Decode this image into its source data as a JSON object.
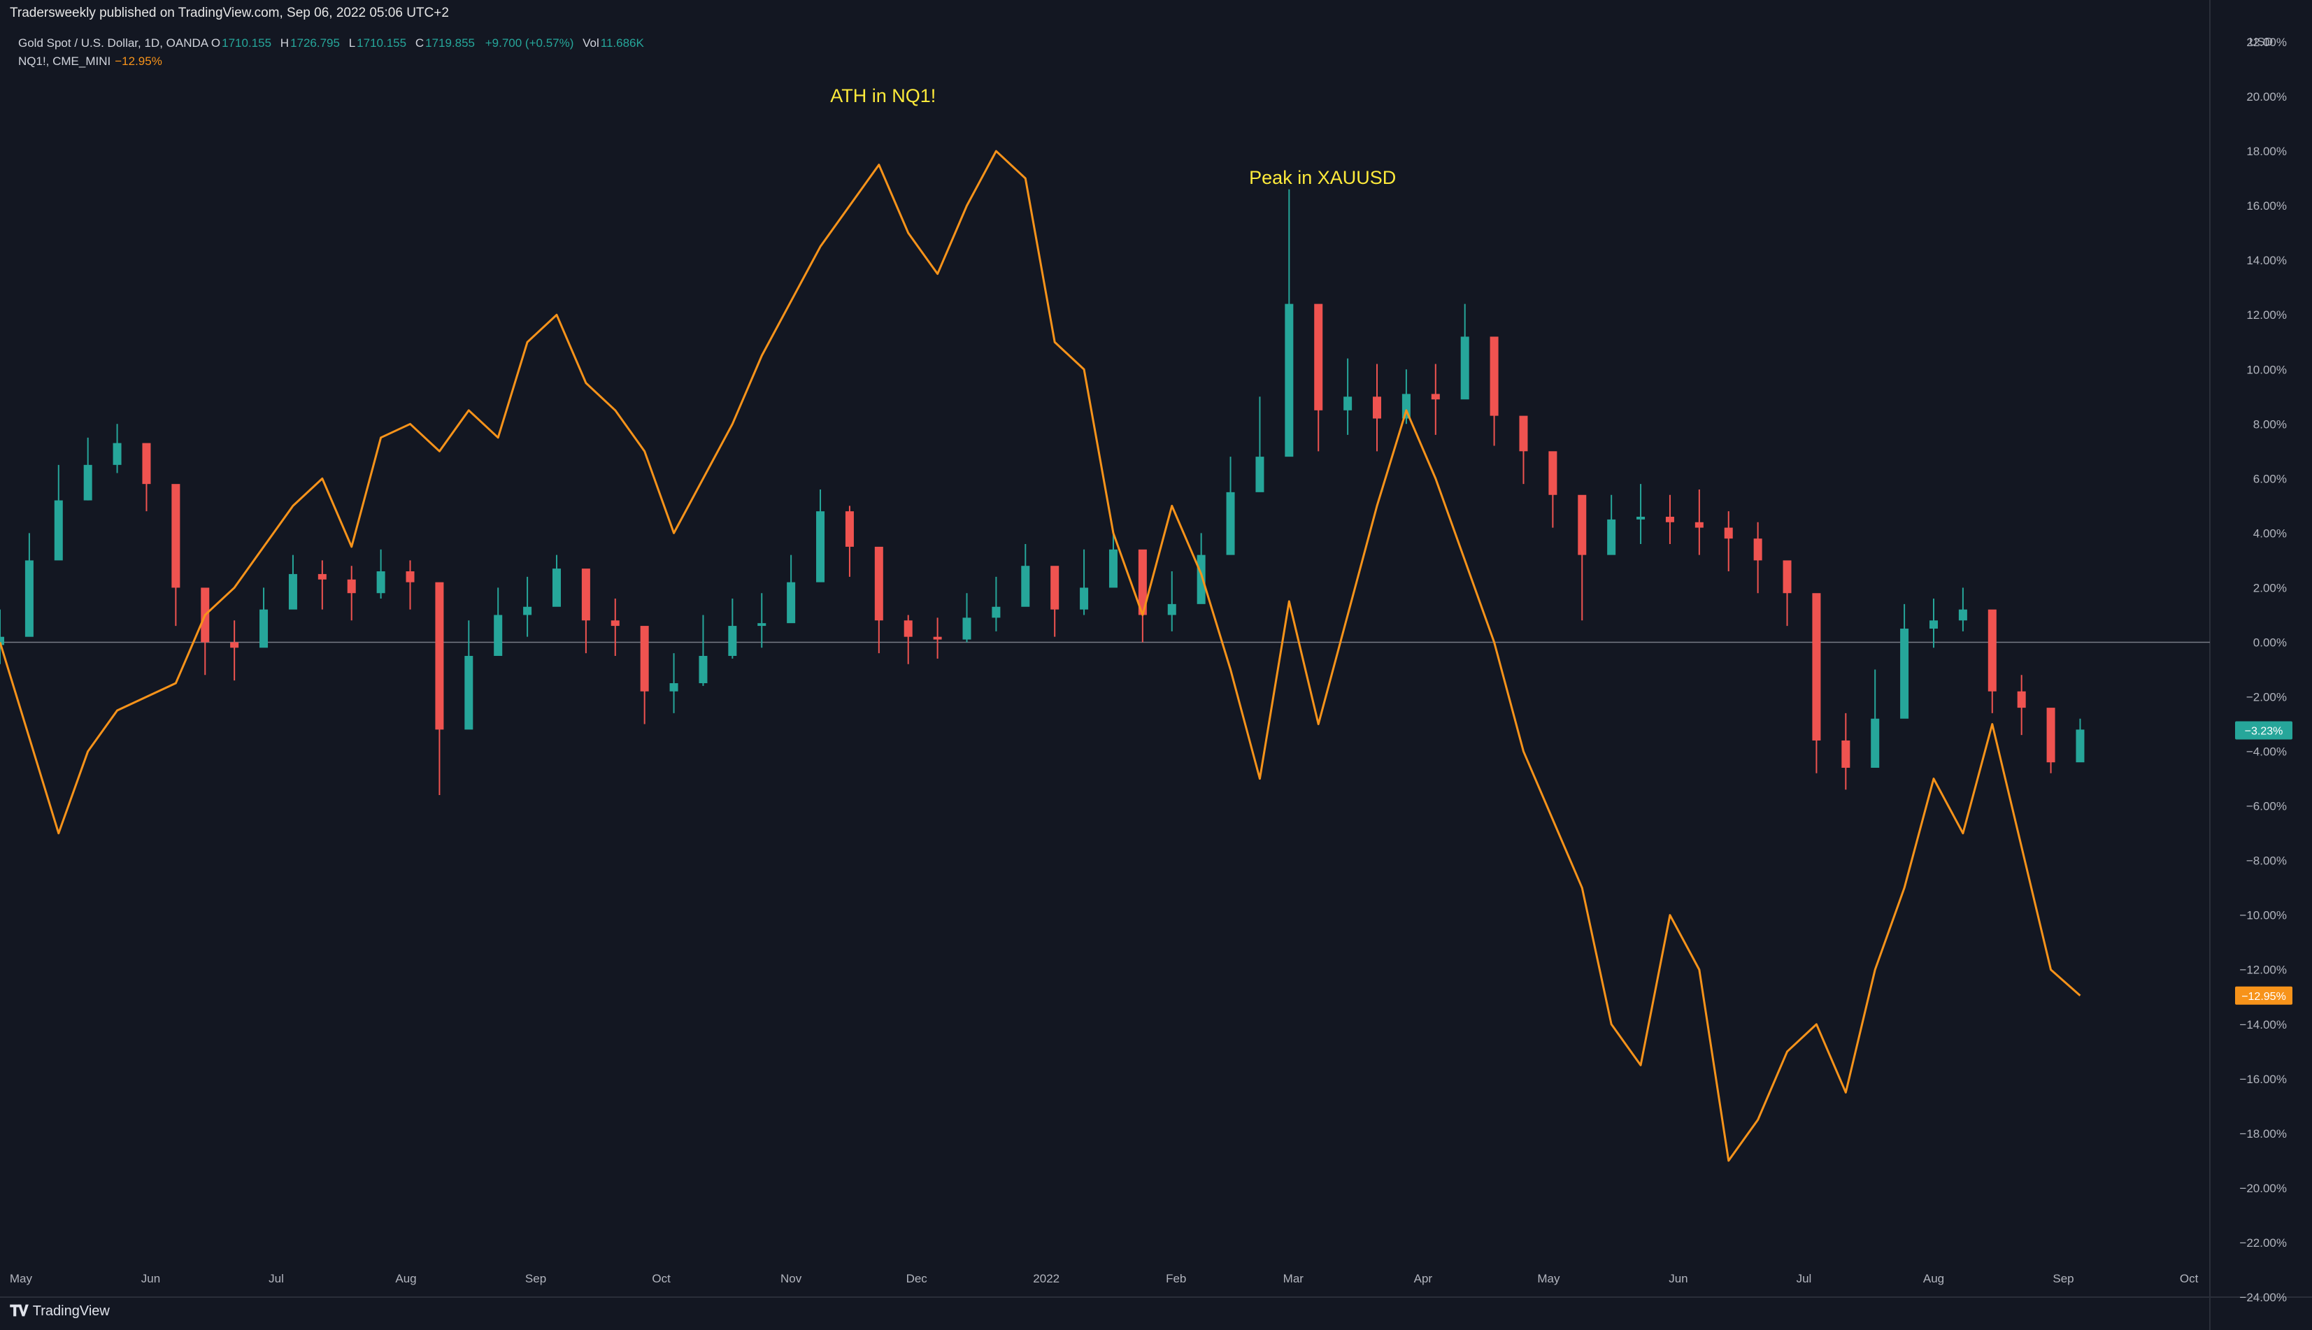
{
  "publish_line": "Tradersweekly published on TradingView.com, Sep 06, 2022 05:06 UTC+2",
  "legend": {
    "gold": {
      "name": "Gold Spot / U.S. Dollar, 1D, OANDA",
      "o_label": "O",
      "o": "1710.155",
      "h_label": "H",
      "h": "1726.795",
      "l_label": "L",
      "l": "1710.155",
      "c_label": "C",
      "c": "1719.855",
      "change": "+9.700 (+0.57%)",
      "vol_label": "Vol",
      "vol": "11.686K"
    },
    "nq": {
      "name": "NQ1!, CME_MINI",
      "value": "−12.95%"
    }
  },
  "currency_label": "USD",
  "footer_logo": "TradingView",
  "colors": {
    "background": "#131722",
    "up_candle": "#26a69a",
    "down_candle": "#ef5350",
    "nq_line": "#f7931a",
    "annotation": "#ffeb3b",
    "zero_line": "#787b86"
  },
  "chart_data": {
    "type": "line",
    "title": "",
    "xlabel": "",
    "ylabel": "",
    "y_unit": "%",
    "ylim": [
      -24,
      22
    ],
    "grid": false,
    "y_ticks": [
      "22.00%",
      "20.00%",
      "18.00%",
      "16.00%",
      "14.00%",
      "12.00%",
      "10.00%",
      "8.00%",
      "6.00%",
      "4.00%",
      "2.00%",
      "0.00%",
      "−2.00%",
      "−4.00%",
      "−6.00%",
      "−8.00%",
      "−10.00%",
      "−12.00%",
      "−14.00%",
      "−16.00%",
      "−18.00%",
      "−20.00%",
      "−22.00%",
      "−24.00%"
    ],
    "y_tick_values": [
      22,
      20,
      18,
      16,
      14,
      12,
      10,
      8,
      6,
      4,
      2,
      0,
      -2,
      -4,
      -6,
      -8,
      -10,
      -12,
      -14,
      -16,
      -18,
      -20,
      -22,
      -24
    ],
    "x_range": [
      "2021-04-26",
      "2022-10-06"
    ],
    "x_ticks": [
      {
        "label": "May",
        "date": "2021-05-01"
      },
      {
        "label": "Jun",
        "date": "2021-06-01"
      },
      {
        "label": "Jul",
        "date": "2021-07-01"
      },
      {
        "label": "Aug",
        "date": "2021-08-01"
      },
      {
        "label": "Sep",
        "date": "2021-09-01"
      },
      {
        "label": "Oct",
        "date": "2021-10-01"
      },
      {
        "label": "Nov",
        "date": "2021-11-01"
      },
      {
        "label": "Dec",
        "date": "2021-12-01"
      },
      {
        "label": "2022",
        "date": "2022-01-01"
      },
      {
        "label": "Feb",
        "date": "2022-02-01"
      },
      {
        "label": "Mar",
        "date": "2022-03-01"
      },
      {
        "label": "Apr",
        "date": "2022-04-01"
      },
      {
        "label": "May",
        "date": "2022-05-01"
      },
      {
        "label": "Jun",
        "date": "2022-06-01"
      },
      {
        "label": "Jul",
        "date": "2022-07-01"
      },
      {
        "label": "Aug",
        "date": "2022-08-01"
      },
      {
        "label": "Sep",
        "date": "2022-09-01"
      },
      {
        "label": "Oct",
        "date": "2022-10-01"
      }
    ],
    "series": [
      {
        "name": "Gold Spot / U.S. Dollar",
        "kind": "candlestick",
        "x": [
          "2021-04-26",
          "2021-05-03",
          "2021-05-10",
          "2021-05-17",
          "2021-05-24",
          "2021-05-31",
          "2021-06-07",
          "2021-06-14",
          "2021-06-21",
          "2021-06-28",
          "2021-07-05",
          "2021-07-12",
          "2021-07-19",
          "2021-07-26",
          "2021-08-02",
          "2021-08-09",
          "2021-08-16",
          "2021-08-23",
          "2021-08-30",
          "2021-09-06",
          "2021-09-13",
          "2021-09-20",
          "2021-09-27",
          "2021-10-04",
          "2021-10-11",
          "2021-10-18",
          "2021-10-25",
          "2021-11-01",
          "2021-11-08",
          "2021-11-15",
          "2021-11-22",
          "2021-11-29",
          "2021-12-06",
          "2021-12-13",
          "2021-12-20",
          "2021-12-27",
          "2022-01-03",
          "2022-01-10",
          "2022-01-17",
          "2022-01-24",
          "2022-01-31",
          "2022-02-07",
          "2022-02-14",
          "2022-02-21",
          "2022-02-28",
          "2022-03-07",
          "2022-03-14",
          "2022-03-21",
          "2022-03-28",
          "2022-04-04",
          "2022-04-11",
          "2022-04-18",
          "2022-04-25",
          "2022-05-02",
          "2022-05-09",
          "2022-05-16",
          "2022-05-23",
          "2022-05-30",
          "2022-06-06",
          "2022-06-13",
          "2022-06-20",
          "2022-06-27",
          "2022-07-04",
          "2022-07-11",
          "2022-07-18",
          "2022-07-25",
          "2022-08-01",
          "2022-08-08",
          "2022-08-15",
          "2022-08-22",
          "2022-08-29",
          "2022-09-05"
        ],
        "values": [
          0.2,
          3.0,
          5.2,
          6.5,
          7.3,
          5.8,
          2.0,
          0.0,
          -0.2,
          1.2,
          2.5,
          2.3,
          1.8,
          2.6,
          2.2,
          -3.2,
          -0.5,
          1.0,
          1.3,
          2.7,
          0.8,
          0.6,
          -1.8,
          -1.5,
          -0.5,
          0.6,
          0.7,
          2.2,
          4.8,
          3.5,
          0.8,
          0.2,
          0.1,
          0.9,
          1.3,
          2.8,
          1.2,
          2.0,
          3.4,
          1.0,
          1.4,
          3.2,
          5.5,
          6.8,
          12.4,
          8.5,
          9.0,
          8.2,
          9.1,
          8.9,
          11.2,
          8.3,
          7.0,
          5.4,
          3.2,
          4.5,
          4.6,
          4.4,
          4.2,
          3.8,
          3.0,
          1.8,
          -3.6,
          -4.6,
          -2.8,
          0.5,
          0.8,
          1.2,
          -1.8,
          -2.4,
          -4.4,
          -3.2
        ],
        "highs": [
          1.2,
          4.0,
          6.5,
          7.5,
          8.0,
          7.0,
          3.0,
          1.5,
          0.8,
          2.0,
          3.2,
          3.0,
          2.8,
          3.4,
          3.0,
          -1.0,
          0.8,
          2.0,
          2.4,
          3.2,
          1.8,
          1.6,
          -0.4,
          -0.4,
          1.0,
          1.6,
          1.8,
          3.2,
          5.6,
          5.0,
          1.6,
          1.0,
          0.9,
          1.8,
          2.4,
          3.6,
          2.4,
          3.4,
          4.0,
          2.2,
          2.6,
          4.0,
          6.8,
          9.0,
          16.6,
          12.0,
          10.4,
          10.2,
          10.0,
          10.2,
          12.4,
          10.6,
          8.2,
          6.6,
          4.6,
          5.4,
          5.8,
          5.4,
          5.6,
          4.8,
          4.4,
          2.8,
          -1.4,
          -2.6,
          -1.0,
          1.4,
          1.6,
          2.0,
          0.4,
          -1.2,
          -3.0,
          -2.8
        ],
        "lows": [
          -0.8,
          1.8,
          4.0,
          5.2,
          6.2,
          4.8,
          0.6,
          -1.2,
          -1.4,
          0.2,
          1.4,
          1.2,
          0.8,
          1.6,
          1.2,
          -5.6,
          -1.8,
          0.0,
          0.2,
          1.6,
          -0.4,
          -0.5,
          -3.0,
          -2.6,
          -1.6,
          -0.6,
          -0.2,
          1.0,
          3.6,
          2.4,
          -0.4,
          -0.8,
          -0.6,
          0.0,
          0.4,
          1.8,
          0.2,
          1.0,
          2.4,
          0.0,
          0.4,
          2.0,
          4.2,
          5.8,
          8.4,
          7.0,
          7.6,
          7.0,
          8.0,
          7.6,
          9.8,
          7.2,
          5.8,
          4.2,
          0.8,
          3.4,
          3.6,
          3.6,
          3.2,
          2.6,
          1.8,
          0.6,
          -4.8,
          -5.4,
          -4.0,
          -0.6,
          -0.2,
          0.4,
          -2.6,
          -3.4,
          -4.8,
          -4.2
        ]
      },
      {
        "name": "NQ1!, CME_MINI",
        "kind": "line",
        "x": [
          "2021-04-26",
          "2021-05-03",
          "2021-05-10",
          "2021-05-17",
          "2021-05-24",
          "2021-05-31",
          "2021-06-07",
          "2021-06-14",
          "2021-06-21",
          "2021-06-28",
          "2021-07-05",
          "2021-07-12",
          "2021-07-19",
          "2021-07-26",
          "2021-08-02",
          "2021-08-09",
          "2021-08-16",
          "2021-08-23",
          "2021-08-30",
          "2021-09-06",
          "2021-09-13",
          "2021-09-20",
          "2021-09-27",
          "2021-10-04",
          "2021-10-11",
          "2021-10-18",
          "2021-10-25",
          "2021-11-01",
          "2021-11-08",
          "2021-11-15",
          "2021-11-22",
          "2021-11-29",
          "2021-12-06",
          "2021-12-13",
          "2021-12-20",
          "2021-12-27",
          "2022-01-03",
          "2022-01-10",
          "2022-01-17",
          "2022-01-24",
          "2022-01-31",
          "2022-02-07",
          "2022-02-14",
          "2022-02-21",
          "2022-02-28",
          "2022-03-07",
          "2022-03-14",
          "2022-03-21",
          "2022-03-28",
          "2022-04-04",
          "2022-04-11",
          "2022-04-18",
          "2022-04-25",
          "2022-05-02",
          "2022-05-09",
          "2022-05-16",
          "2022-05-23",
          "2022-05-30",
          "2022-06-06",
          "2022-06-13",
          "2022-06-20",
          "2022-06-27",
          "2022-07-04",
          "2022-07-11",
          "2022-07-18",
          "2022-07-25",
          "2022-08-01",
          "2022-08-08",
          "2022-08-15",
          "2022-08-22",
          "2022-08-29",
          "2022-09-05"
        ],
        "values": [
          0.0,
          -3.5,
          -7.0,
          -4.0,
          -2.5,
          -2.0,
          -1.5,
          1.0,
          2.0,
          3.5,
          5.0,
          6.0,
          3.5,
          7.5,
          8.0,
          7.0,
          8.5,
          7.5,
          11.0,
          12.0,
          9.5,
          8.5,
          7.0,
          4.0,
          6.0,
          8.0,
          10.5,
          12.5,
          14.5,
          16.0,
          17.5,
          15.0,
          13.5,
          16.0,
          18.0,
          17.0,
          11.0,
          10.0,
          4.0,
          1.0,
          5.0,
          2.5,
          -1.0,
          -5.0,
          1.5,
          -3.0,
          1.0,
          5.0,
          8.5,
          6.0,
          3.0,
          0.0,
          -4.0,
          -6.5,
          -9.0,
          -14.0,
          -15.5,
          -10.0,
          -12.0,
          -19.0,
          -17.5,
          -15.0,
          -14.0,
          -16.5,
          -12.0,
          -9.0,
          -5.0,
          -7.0,
          -3.0,
          -7.5,
          -12.0,
          -12.95
        ]
      }
    ],
    "last_value_labels": [
      {
        "series": "Gold Spot / U.S. Dollar",
        "value": "−3.23%",
        "y": -3.23
      },
      {
        "series": "NQ1!, CME_MINI",
        "value": "−12.95%",
        "y": -12.95
      }
    ],
    "annotations": [
      {
        "text": "ATH in NQ1!",
        "date": "2021-11-23",
        "y": 20.0
      },
      {
        "text": "Peak in XAUUSD",
        "date": "2022-03-08",
        "y": 17.0
      }
    ]
  }
}
